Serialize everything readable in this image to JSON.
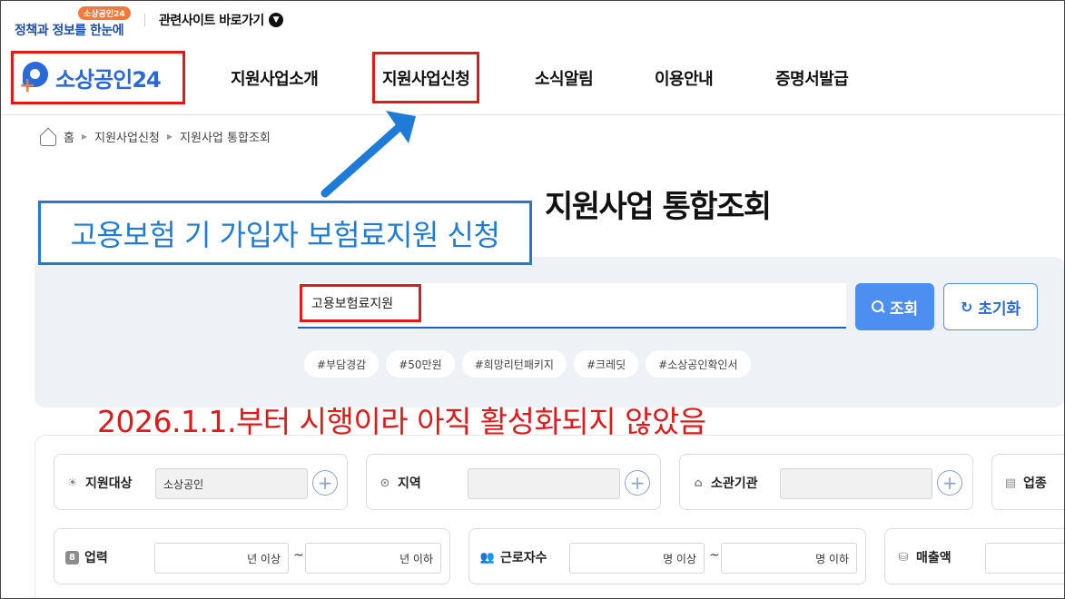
{
  "topbar": {
    "promo_badge": "소상공인24",
    "promo_text": "정책과 정보를 한눈에",
    "related_label": "관련사이트 바로가기"
  },
  "header": {
    "logo_text": "소상공인24",
    "nav": [
      "지원사업소개",
      "지원사업신청",
      "소식알림",
      "이용안내",
      "증명서발급"
    ],
    "highlighted_nav": "지원사업신청"
  },
  "breadcrumb": [
    "홈",
    "지원사업신청",
    "지원사업 통합조회"
  ],
  "page_title": "지원사업 통합조회",
  "annotations": {
    "blue_box": "고용보험 기 가입자 보험료지원 신청",
    "red_note": "2026.1.1.부터 시행이라 아직 활성화되지 않았음"
  },
  "search": {
    "value": "고용보험료지원",
    "search_button": "조회",
    "reset_button": "초기화",
    "tags": [
      "#부담경감",
      "#50만원",
      "#희망리턴패키지",
      "#크레딧",
      "#소상공인확인서"
    ]
  },
  "filters": {
    "target": {
      "label": "지원대상",
      "value": "소상공인"
    },
    "region": {
      "label": "지역",
      "value": ""
    },
    "agency": {
      "label": "소관기관",
      "value": ""
    },
    "industry": {
      "label": "업종"
    },
    "years": {
      "label": "업력",
      "min_suffix": "년 이상",
      "max_suffix": "년 이하",
      "sep": "~"
    },
    "workers": {
      "label": "근로자수",
      "min_suffix": "명 이상",
      "max_suffix": "명 이하",
      "sep": "~"
    },
    "sales": {
      "label": "매출액"
    }
  },
  "colors": {
    "brand_blue": "#2a6ad8",
    "search_button": "#4d8ff0",
    "annotation_red": "#e01919",
    "annotation_blue": "#1e7bd8",
    "promo_orange": "#f4793b"
  }
}
